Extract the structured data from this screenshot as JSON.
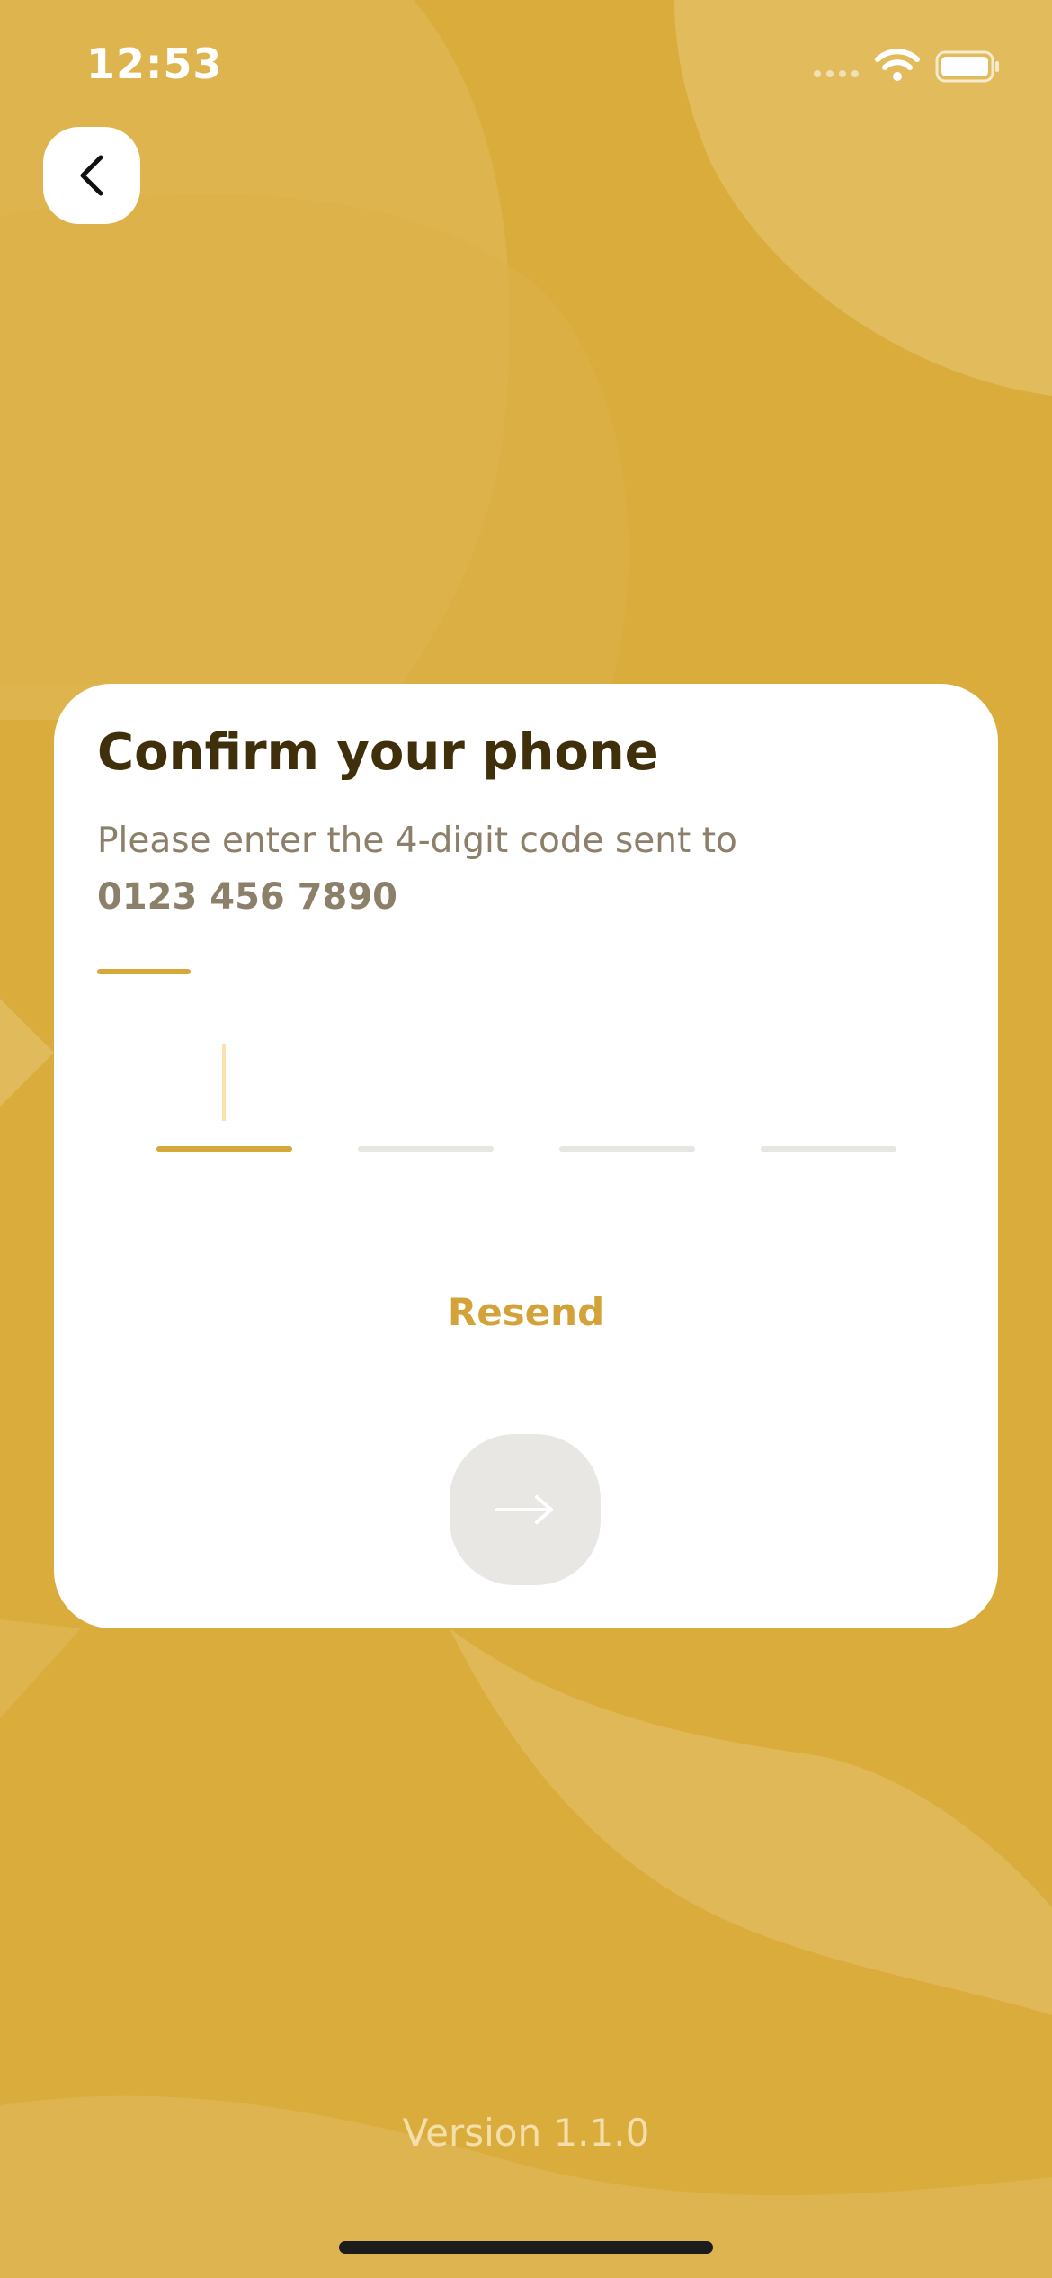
{
  "status_bar": {
    "time": "12:53"
  },
  "header": {
    "back_icon": "chevron-left-icon"
  },
  "card": {
    "title": "Confirm your phone",
    "subtitle": "Please enter the 4-digit code sent to",
    "phone_number": "0123 456 7890",
    "code_slots": [
      "",
      "",
      "",
      ""
    ],
    "active_slot": 1,
    "resend_label": "Resend",
    "next_icon": "arrow-right-icon"
  },
  "footer": {
    "version": "Version 1.1.0"
  },
  "colors": {
    "background": "#d9ac3c",
    "accent": "#d5a83a",
    "title_text": "#3f2f0b",
    "body_text": "#8c806a",
    "disabled_button": "#e9e7e3"
  }
}
